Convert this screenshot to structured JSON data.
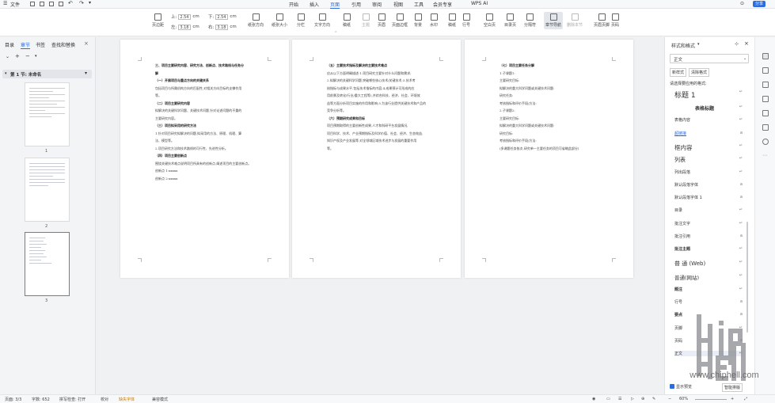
{
  "title_bar": {
    "file_label": "文件",
    "menus": [
      "开始",
      "插入",
      "页面",
      "引用",
      "审阅",
      "视图",
      "工具",
      "会员专享",
      "WPS AI"
    ],
    "active_menu": "页面",
    "share_label": "分享"
  },
  "ribbon": {
    "page_margin_label": "页边距",
    "margin_top_label": "上:",
    "margin_top_value": "2.54",
    "margin_bottom_label": "下:",
    "margin_bottom_value": "2.54",
    "margin_left_label": "左:",
    "margin_left_value": "3.18",
    "margin_right_label": "右:",
    "margin_right_value": "3.18",
    "unit": "cm",
    "buttons": [
      "纸张方向",
      "纸张大小",
      "分栏",
      "文字方向",
      "稿纸",
      "主题",
      "页眉",
      "页面边框",
      "背景",
      "水印",
      "稿纸",
      "行号",
      "空白页",
      "目录页",
      "分隔符",
      "章节导航",
      "删除本节",
      "页眉页脚",
      "页码"
    ]
  },
  "left_panel": {
    "tabs": [
      "目录",
      "章节",
      "书签",
      "查找和替换"
    ],
    "active_tab": "章节",
    "section_label": "第 1 节: 未命名",
    "page_numbers": [
      "1",
      "2",
      "3"
    ]
  },
  "pages": [
    {
      "lines": [
        {
          "t": "三、项目主要研究内容、研究方法、创新点、技术路线与任务分",
          "h": true
        },
        {
          "t": "解",
          "h": true
        },
        {
          "t": "（一）开展项目与重点方向的关键关系",
          "h": true
        },
        {
          "t": "包括项目与所属机构方向的匹配性,对相关方向目标的支撑作用",
          "h": false
        },
        {
          "t": "等。",
          "h": false
        },
        {
          "t": "（二）项目主要研究内容",
          "h": true
        },
        {
          "t": "拟解决的关键科学问题、关键技术问题,针对论述问题的不重的",
          "h": false
        },
        {
          "t": "主要研究内容。",
          "h": false
        },
        {
          "t": "（三）项目拟采用的研究方法",
          "h": true
        },
        {
          "t": "1.针对项目研究拟解决的问题,拟采用的方法、原理、机理、算",
          "h": false
        },
        {
          "t": "法、模型等。",
          "h": false
        },
        {
          "t": "2.项目研究方法和技术路线的可行性、先进性分析。",
          "h": false
        },
        {
          "t": "（四）项目主要创新点",
          "h": true
        },
        {
          "t": "围绕关键技术难点说明项目所具有的创新点,阐述项目的主要创新点。",
          "h": false
        },
        {
          "t": "创新点 1:xxxxx",
          "h": false
        },
        {
          "t": "创新点 2:xxxxx",
          "h": false
        }
      ]
    },
    {
      "lines": [
        {
          "t": "（五）主要技术指标及解决的主要技术难点",
          "h": true
        },
        {
          "t": "应从以下方面明确描述:1.项目研究主要针对什么问题和需求;",
          "h": false
        },
        {
          "t": "2.拟解决的关键科学问题,突破哪些核心技术/关键技术;3.技术考",
          "h": false
        },
        {
          "t": "核指标与成果水平,包括技术指标的内容;4.成果预计可形成的应",
          "h": false
        },
        {
          "t": "用前景及转化(行业/重大工程等),并综合科技、经济、社会、环境效",
          "h": false
        },
        {
          "t": "益等方面分析项目实施的作用和影响;5.为该行业提供关键技术和产品的",
          "h": false
        },
        {
          "t": "竞争分析等。",
          "h": false
        },
        {
          "t": "（六）预期研究成果和目标",
          "h": true
        },
        {
          "t": "项目预期取得的主要创新性成果,人才和科研平台发展情况,",
          "h": false
        },
        {
          "t": "项目科学、技术、产业预期指标及科学价值、社会、经济、生态效益,",
          "h": false
        },
        {
          "t": "知识产权及产业发展等,对全领域区域技术进步与发展的重要作用",
          "h": false
        },
        {
          "t": "等。",
          "h": false
        }
      ]
    },
    {
      "lines": [
        {
          "t": "（七）项目主要任务分解",
          "h": true
        },
        {
          "t": "1.子课题1:",
          "h": false
        },
        {
          "t": "主要研究目标:",
          "h": false
        },
        {
          "t": "拟解决的重大科学问题或关键技术问题:",
          "h": false
        },
        {
          "t": "研究任务:",
          "h": false
        },
        {
          "t": "考核指标和评价手段/方法:",
          "h": false
        },
        {
          "t": "2.子课题2:",
          "h": false
        },
        {
          "t": "主要研究目标:",
          "h": false
        },
        {
          "t": "拟解决的重大科学问题或关键技术问题:",
          "h": false
        },
        {
          "t": "研究目标:",
          "h": false
        },
        {
          "t": "考核指标和评价手段/方法:",
          "h": false
        },
        {
          "t": "(多课题任务依次,研究单一主要任务的项目可省略此部分)",
          "h": false
        }
      ]
    }
  ],
  "right_panel": {
    "title": "样式和格式",
    "current_style": "正文",
    "new_style_label": "新样式",
    "clear_format_label": "清除格式",
    "select_label": "请选择要应用的格式:",
    "styles": [
      {
        "name": "标题 1",
        "mark": "↵"
      },
      {
        "name": "表格标题",
        "mark": "↵"
      },
      {
        "name": "表格内容",
        "mark": "↵"
      },
      {
        "name": "超链接",
        "mark": "a"
      },
      {
        "name": "框内容",
        "mark": "↵"
      },
      {
        "name": "列表",
        "mark": "↵"
      },
      {
        "name": "列出段落",
        "mark": "↵"
      },
      {
        "name": "默认段落字体",
        "mark": "a"
      },
      {
        "name": "默认段落字体 1",
        "mark": "a"
      },
      {
        "name": "目录",
        "mark": "↵"
      },
      {
        "name": "批注文字",
        "mark": "↵"
      },
      {
        "name": "批注引用",
        "mark": "a"
      },
      {
        "name": "批注主题",
        "mark": "↵"
      },
      {
        "name": "普 通 (Web)",
        "mark": "↵"
      },
      {
        "name": "普通(网站)",
        "mark": "↵"
      },
      {
        "name": "题注",
        "mark": "↵"
      },
      {
        "name": "行号",
        "mark": "a"
      },
      {
        "name": "要点",
        "mark": "a"
      },
      {
        "name": "页脚",
        "mark": "↵"
      },
      {
        "name": "页码",
        "mark": "a"
      },
      {
        "name": "正文",
        "mark": "↵"
      }
    ],
    "show_preview_label": "显示预览",
    "smart_format_label": "智能排版"
  },
  "status_bar": {
    "page": "页面: 3/3",
    "words": "字数: 652",
    "spell": "拼写检查: 打开",
    "proof": "校对",
    "missing_font": "缺失字体",
    "compat": "兼容模式",
    "zoom": "60%"
  },
  "watermark": {
    "text": "www.chiphell.com",
    "logo_text": "chip hell"
  }
}
